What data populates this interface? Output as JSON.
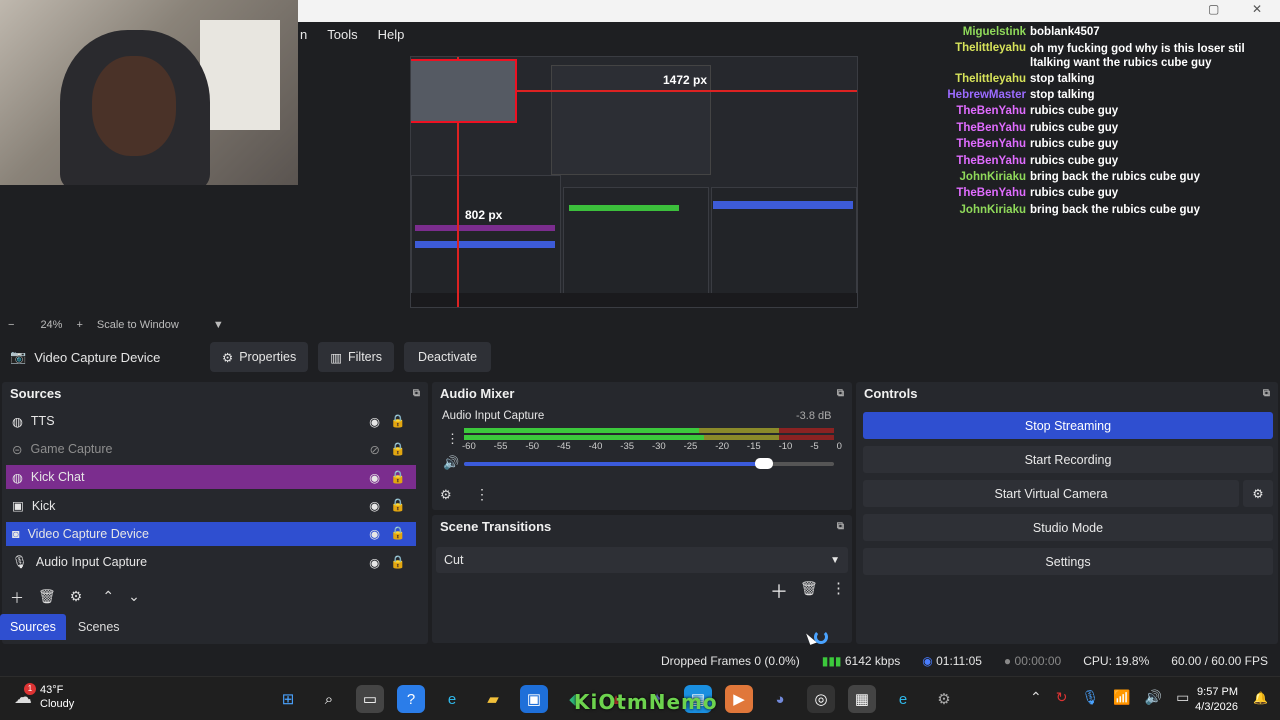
{
  "menu": {
    "partial": "n",
    "tools": "Tools",
    "help": "Help"
  },
  "preview": {
    "label_width": "1472 px",
    "label_height": "802 px",
    "zoom": "24%",
    "scale_mode": "Scale to Window"
  },
  "chat": {
    "messages": [
      {
        "user": "Miguelstink",
        "color": "#8fd95a",
        "text": "boblank4507"
      },
      {
        "user": "Thelittleyahu",
        "color": "#d7e35a",
        "text": "oh my fucking god why is this loser stil ltalking want the rubics cube guy",
        "two": true
      },
      {
        "user": "Thelittleyahu",
        "color": "#d7e35a",
        "text": "stop talking"
      },
      {
        "user": "HebrewMaster",
        "color": "#9b6bff",
        "text": "stop talking"
      },
      {
        "user": "TheBenYahu",
        "color": "#e06cff",
        "text": "rubics cube guy"
      },
      {
        "user": "TheBenYahu",
        "color": "#e06cff",
        "text": "rubics cube guy"
      },
      {
        "user": "TheBenYahu",
        "color": "#e06cff",
        "text": "rubics cube guy"
      },
      {
        "user": "TheBenYahu",
        "color": "#e06cff",
        "text": "rubics cube guy"
      },
      {
        "user": "JohnKiriaku",
        "color": "#8fd95a",
        "text": "bring back the rubics cube guy"
      },
      {
        "user": "TheBenYahu",
        "color": "#e06cff",
        "text": "rubics cube guy"
      },
      {
        "user": "JohnKiriaku",
        "color": "#8fd95a",
        "text": "bring back the rubics cube guy"
      }
    ]
  },
  "context": {
    "source_name": "Video Capture Device",
    "properties": "Properties",
    "filters": "Filters",
    "deactivate": "Deactivate"
  },
  "sources": {
    "title": "Sources",
    "items": [
      {
        "label": "TTS",
        "icon": "globe-icon"
      },
      {
        "label": "Game Capture",
        "icon": "gamepad-icon"
      },
      {
        "label": "Kick Chat",
        "icon": "globe-icon"
      },
      {
        "label": "Kick",
        "icon": "window-icon"
      },
      {
        "label": "Video Capture Device",
        "icon": "camera-icon"
      },
      {
        "label": "Audio Input Capture",
        "icon": "microphone-icon"
      }
    ],
    "tab_sources": "Sources",
    "tab_scenes": "Scenes"
  },
  "mixer": {
    "title": "Audio Mixer",
    "channel": "Audio Input Capture",
    "level": "-3.8 dB",
    "ticks": [
      "-60",
      "-55",
      "-50",
      "-45",
      "-40",
      "-35",
      "-30",
      "-25",
      "-20",
      "-15",
      "-10",
      "-5",
      "0"
    ],
    "volume_fraction": 0.81
  },
  "transitions": {
    "title": "Scene Transitions",
    "selected": "Cut"
  },
  "controls": {
    "title": "Controls",
    "stop_streaming": "Stop Streaming",
    "start_recording": "Start Recording",
    "start_virtual_camera": "Start Virtual Camera",
    "studio_mode": "Studio Mode",
    "settings": "Settings"
  },
  "status": {
    "dropped_frames": "Dropped Frames 0 (0.0%)",
    "bitrate": "6142 kbps",
    "stream_time": "01:11:05",
    "rec_time": "00:00:00",
    "cpu": "CPU: 19.8%",
    "fps": "60.00 / 60.00 FPS"
  },
  "taskbar": {
    "temperature": "43°F",
    "condition": "Cloudy",
    "weather_badge": "1",
    "time": "9:57 PM",
    "date": "4/3/2026",
    "watermark": "KiOtmNemo"
  },
  "colors": {
    "accent": "#2f4fd0",
    "kick": "#7b2d8e"
  }
}
